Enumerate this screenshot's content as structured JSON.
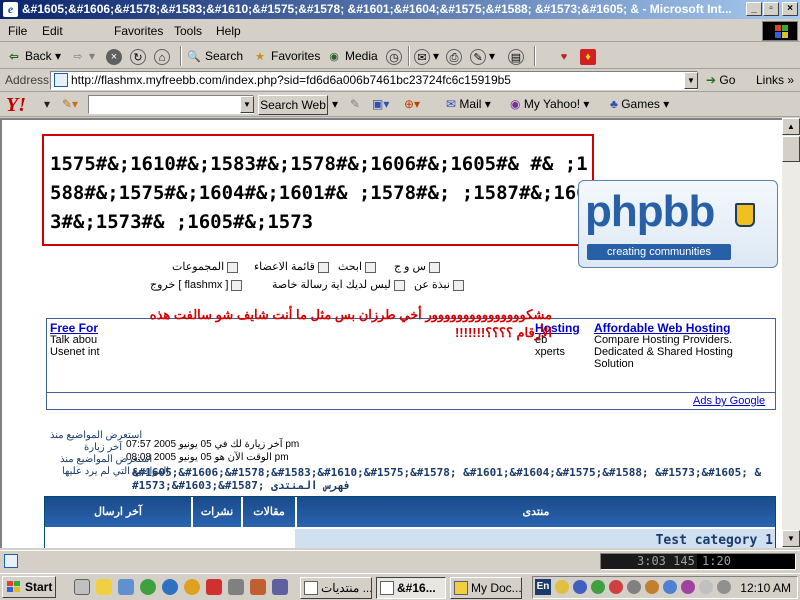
{
  "window": {
    "title": "&#1605;&#1606;&#1578;&#1583;&#1610;&#1575;&#1578; &#1601;&#1604;&#1575;&#1588; &#1573;&#1605; & - Microsoft Int..."
  },
  "menu": {
    "items": [
      "File",
      "Edit",
      "Favorites",
      "Tools",
      "Help"
    ],
    "hotkeys": [
      "F",
      "E",
      "F",
      "T",
      "H"
    ]
  },
  "toolbar": {
    "back": "Back",
    "search": "Search",
    "favorites": "Favorites",
    "media": "Media"
  },
  "address": {
    "label": "Address",
    "url": "http://flashmx.myfreebb.com/index.php?sid=fd6d6a006b7461bc23724fc6c15919b5",
    "go": "Go",
    "links": "Links"
  },
  "yahoo": {
    "logo": "Y!",
    "search_button": "Search Web",
    "mail": "Mail",
    "my_yahoo": "My Yahoo!",
    "games": "Games"
  },
  "page": {
    "title_numeric": "1575#&;1610#&;1583#&;1578#&;1606#&;1605#& #& ;1588#&;1575#&;1604#&;1601#& ;1578#&; ;1587#&;1603#&;1573#& ;1605#&;1573",
    "logo": {
      "text": "phpbb",
      "subtitle": "creating communities"
    },
    "nav": {
      "faq": "س و ج",
      "search": "ابحث",
      "members": "قائمة الاعضاء",
      "groups": "المجموعات",
      "profile": "نبذة عن",
      "pm": "ليس لديك اية رسالة خاصة",
      "logout": "خروج [ flashmx ]"
    },
    "comment": "مشكووووووووووووووور أخي طرزان بس مثل ما أنت شايف شو سالفت هذه الأرقام ؟؟؟؟!!!!!!!",
    "ads": {
      "left_link": "Free For",
      "left_text": "Talk abou\nUsenet int",
      "mid_link": "Hosting",
      "mid_text": "eb\nxperts",
      "right_link": "Affordable Web Hosting",
      "right_text": "Compare Hosting Providers. Dedicated & Shared Hosting Solution",
      "attribution": "Ads by Google"
    },
    "info": {
      "new_posts_link": "استعرض المواضيع منذ",
      "last_visit_label": "آخر زيارة",
      "last_visit": "آخر زيارة لك في 05 يونيو 2005 07:57 pm",
      "current_time": "الوقت الآن هو 05 يونيو 2005 08:08 pm",
      "your_posts": "استعرض المواضيع منذ",
      "unanswered": "المواضيع التي لم يرد عليها"
    },
    "breadcrumb": "&#1605;&#1606;&#1578;&#1583;&#1610;&#1575;&#1578; &#1601;&#1604;&#1575;&#1588; &#1573;&#1605; &#1573;&#1603;&#1587; فهرس المنتدى",
    "table": {
      "col_forum": "منتدى",
      "col_topics": "مقالات",
      "col_posts": "نشرات",
      "col_last": "آخر ارسال",
      "category": "Test category 1"
    }
  },
  "statusbar": {
    "progress_text": "3:03 145 1:20"
  },
  "taskbar": {
    "start": "Start",
    "tasks": [
      "منتديات ...",
      "&#16...",
      "My Doc..."
    ],
    "lang": "En",
    "clock": "12:10 AM"
  }
}
